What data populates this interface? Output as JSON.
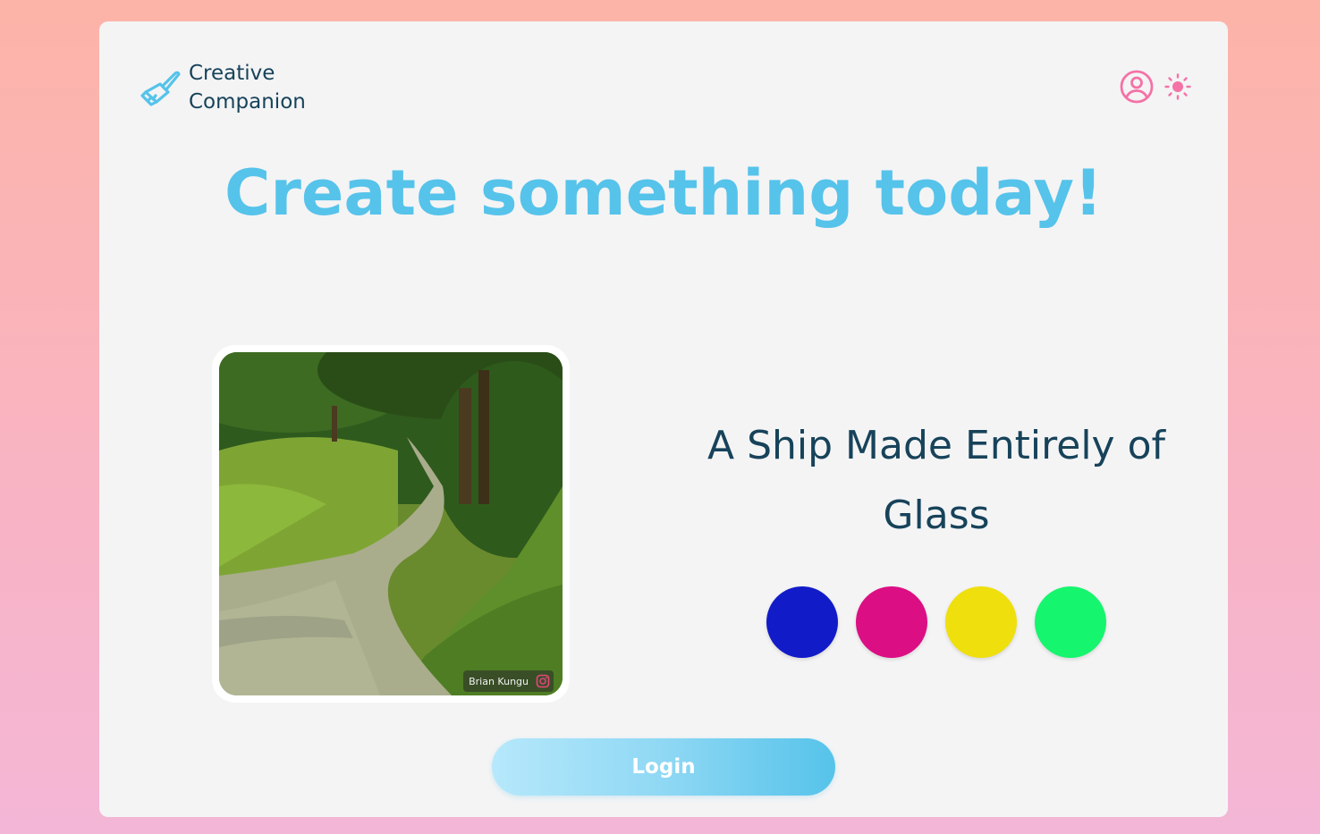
{
  "app": {
    "name_line1": "Creative",
    "name_line2": "Companion",
    "logo_icon": "paintbrush-icon"
  },
  "header": {
    "account_icon": "user-circle-icon",
    "theme_icon": "sun-icon"
  },
  "hero": {
    "headline": "Create something today!"
  },
  "inspiration": {
    "photo_credit": "Brian Kungu",
    "credit_icon": "instagram-icon",
    "prompt": "A Ship Made Entirely of Glass",
    "colors": [
      "#121bc8",
      "#dc0e84",
      "#efdf0d",
      "#16f56e"
    ]
  },
  "actions": {
    "login_label": "Login"
  },
  "theme": {
    "accent": "#56c3ea",
    "text_dark": "#17435a",
    "icon_pink": "#f472a6"
  }
}
